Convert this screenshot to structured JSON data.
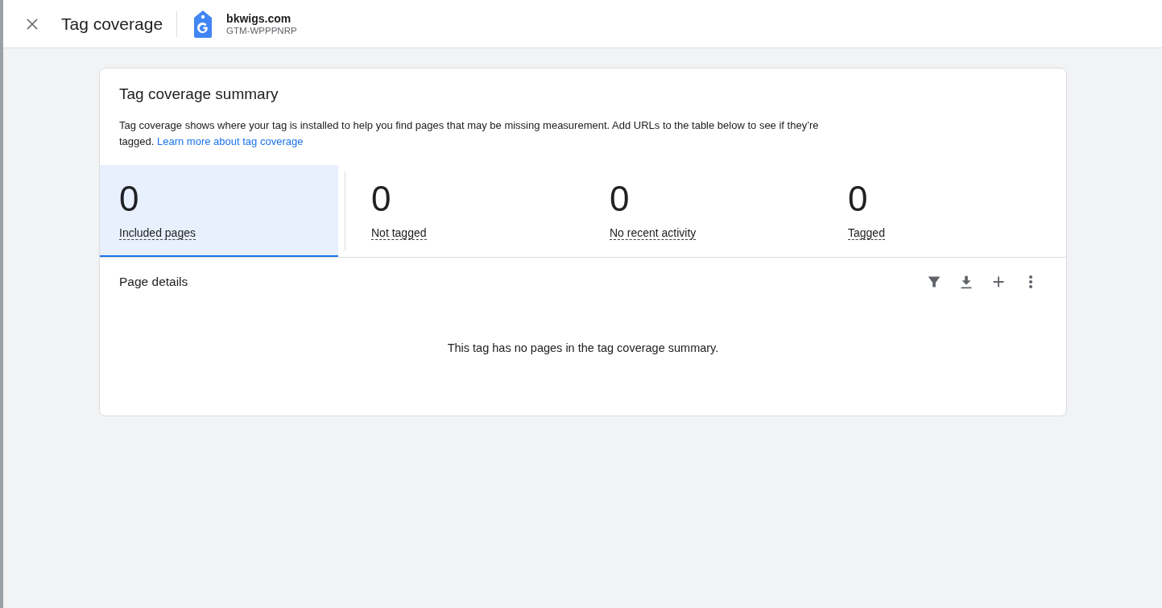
{
  "header": {
    "title": "Tag coverage",
    "site": "bkwigs.com",
    "container_id": "GTM-WPPPNRP"
  },
  "summary": {
    "title": "Tag coverage summary",
    "description": "Tag coverage shows where your tag is installed to help you find pages that may be missing measurement. Add URLs to the table below to see if they’re tagged.",
    "link": "Learn more about tag coverage",
    "metrics": [
      {
        "value": "0",
        "label": "Included pages",
        "selected": true
      },
      {
        "value": "0",
        "label": "Not tagged",
        "selected": false
      },
      {
        "value": "0",
        "label": "No recent activity",
        "selected": false
      },
      {
        "value": "0",
        "label": "Tagged",
        "selected": false
      }
    ]
  },
  "page_details": {
    "title": "Page details",
    "empty_message": "This tag has no pages in the tag coverage summary."
  }
}
